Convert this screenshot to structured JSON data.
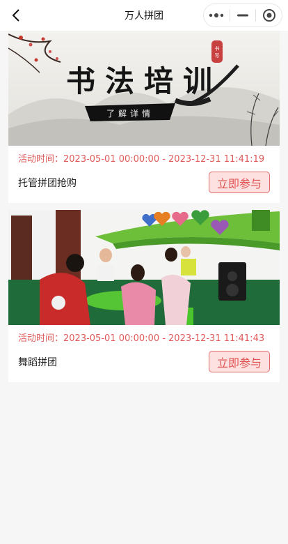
{
  "header": {
    "title": "万人拼团",
    "back_icon": "chevron-left-icon",
    "more_icon": "more-dots-icon",
    "minimize_icon": "minimize-icon",
    "close_icon": "target-circle-icon"
  },
  "activities": [
    {
      "image": "calligraphy-banner",
      "banner_text": "书法培训",
      "banner_subtext": "了解详情",
      "time_label": "活动时间：",
      "time_value": "2023-05-01 00:00:00 - 2023-12-31 11:41:19",
      "name": "托管拼团抢购",
      "button_label": "立即参与"
    },
    {
      "image": "classroom-photo",
      "time_label": "活动时间：",
      "time_value": "2023-05-01 00:00:00 - 2023-12-31 11:41:43",
      "name": "舞蹈拼团",
      "button_label": "立即参与"
    }
  ],
  "colors": {
    "accent_red": "#e05a5a",
    "button_bg": "#fde1e1",
    "page_bg": "#f6f6f6"
  }
}
